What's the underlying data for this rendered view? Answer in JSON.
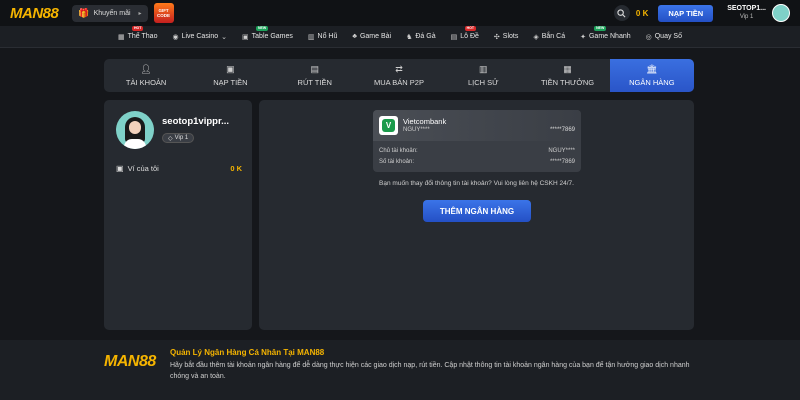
{
  "header": {
    "logo_text": "MAN88",
    "promo_label": "Khuyến mãi",
    "giftcode_label": "GIFT CODE",
    "balance": "0 K",
    "deposit_label": "NẠP TIỀN",
    "username": "SEOTOP1...",
    "vip_level": "Vip 1"
  },
  "nav": {
    "items": [
      {
        "label": "Thể Thao",
        "badge": "HOT",
        "icon": "sports-icon"
      },
      {
        "label": "Live Casino",
        "badge": "",
        "icon": "casino-icon"
      },
      {
        "label": "Table Games",
        "badge": "NEW",
        "icon": "table-games-icon"
      },
      {
        "label": "Nổ Hũ",
        "badge": "",
        "icon": "jackpot-icon"
      },
      {
        "label": "Game Bài",
        "badge": "",
        "icon": "cards-icon"
      },
      {
        "label": "Đá Gà",
        "badge": "",
        "icon": "rooster-icon"
      },
      {
        "label": "Lô Đề",
        "badge": "HOT",
        "icon": "lottery-icon"
      },
      {
        "label": "Slots",
        "badge": "",
        "icon": "slots-icon"
      },
      {
        "label": "Bắn Cá",
        "badge": "",
        "icon": "fish-icon"
      },
      {
        "label": "Game Nhanh",
        "badge": "NEW",
        "icon": "fast-game-icon"
      },
      {
        "label": "Quay Số",
        "badge": "",
        "icon": "number-draw-icon"
      }
    ]
  },
  "tabs": [
    {
      "label": "TÀI KHOẢN",
      "icon": "user-icon"
    },
    {
      "label": "NẠP TIỀN",
      "icon": "deposit-icon"
    },
    {
      "label": "RÚT TIỀN",
      "icon": "withdraw-icon"
    },
    {
      "label": "MUA BÁN P2P",
      "icon": "p2p-icon"
    },
    {
      "label": "LỊCH SỬ",
      "icon": "history-icon"
    },
    {
      "label": "TIỀN THƯỞNG",
      "icon": "bonus-icon"
    },
    {
      "label": "NGÂN HÀNG",
      "icon": "bank-icon",
      "active": true
    }
  ],
  "profile": {
    "name": "seotop1vippr...",
    "vip": "Vip 1",
    "wallet_label": "Ví của tôi",
    "wallet_value": "0 K"
  },
  "bank_card": {
    "bank_name": "Vietcombank",
    "account_name_short": "NGUY****",
    "account_number_short": "*****7869",
    "holder_label": "Chủ tài khoản:",
    "holder_value": "NGUY****",
    "number_label": "Số tài khoản:",
    "number_value": "*****7869"
  },
  "info_text": "Bạn muốn thay đổi thông tin tài khoản? Vui lòng liên hệ CSKH 24/7.",
  "add_bank_label": "THÊM NGÂN HÀNG",
  "footer": {
    "logo_text": "MAN88",
    "title": "Quản Lý Ngân Hàng Cá Nhân Tại MAN88",
    "description": "Hãy bắt đầu thêm tài khoản ngân hàng để dễ dàng thực hiện các giao dịch nạp, rút tiền. Cập nhật thông tin tài khoản ngân hàng của bạn để tận hưởng giao dịch nhanh chóng và an toàn."
  },
  "colors": {
    "accent_blue": "#2f62d8",
    "gold": "#f5b400",
    "panel": "#262a30",
    "background": "#15171b"
  }
}
